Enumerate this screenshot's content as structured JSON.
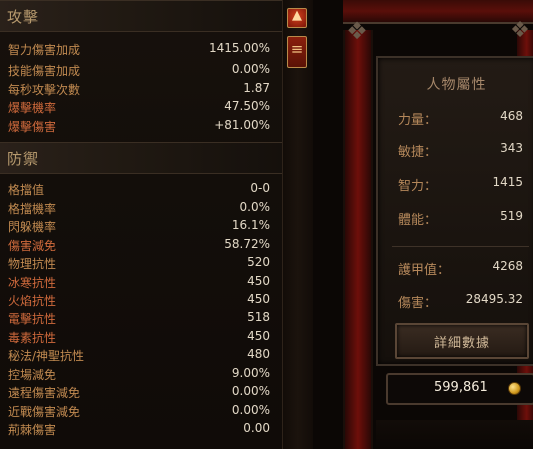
{
  "offense": {
    "title": "攻擊",
    "stats": [
      {
        "label": "智力傷害加成",
        "value": "1415.00%"
      },
      {
        "label": "技能傷害加成",
        "value": "0.00%"
      },
      {
        "label": "每秒攻擊次數",
        "value": "1.87"
      },
      {
        "label": "爆擊機率",
        "value": "47.50%"
      },
      {
        "label": "爆擊傷害",
        "value": "+81.00%"
      }
    ]
  },
  "defense": {
    "title": "防禦",
    "stats": [
      {
        "label": "格擋值",
        "value": "0-0"
      },
      {
        "label": "格擋機率",
        "value": "0.0%"
      },
      {
        "label": "閃躲機率",
        "value": "16.1%"
      },
      {
        "label": "傷害減免",
        "value": "58.72%"
      },
      {
        "label": "物理抗性",
        "value": "520"
      },
      {
        "label": "冰寒抗性",
        "value": "450"
      },
      {
        "label": "火焰抗性",
        "value": "450"
      },
      {
        "label": "電擊抗性",
        "value": "518"
      },
      {
        "label": "毒素抗性",
        "value": "450"
      },
      {
        "label": "秘法/神聖抗性",
        "value": "480"
      },
      {
        "label": "控場減免",
        "value": "9.00%"
      },
      {
        "label": "遠程傷害減免",
        "value": "0.00%"
      },
      {
        "label": "近戰傷害減免",
        "value": "0.00%"
      },
      {
        "label": "荊棘傷害",
        "value": "0.00"
      }
    ]
  },
  "attributes": {
    "title": "人物屬性",
    "primary": [
      {
        "label": "力量：",
        "value": "468"
      },
      {
        "label": "敏捷：",
        "value": "343"
      },
      {
        "label": "智力：",
        "value": "1415"
      },
      {
        "label": "體能：",
        "value": "519"
      }
    ],
    "secondary": [
      {
        "label": "護甲值：",
        "value": "4268"
      },
      {
        "label": "傷害：",
        "value": "28495.32"
      }
    ],
    "details_button": "詳細數據"
  },
  "gold": {
    "amount": "599,861",
    "icon": "gold-coin-icon"
  },
  "scrollbar": {
    "up_icon": "scroll-up-arrow-icon",
    "thumb_icon": "scroll-thumb-icon"
  },
  "colors": {
    "label_orange": "#c18a50",
    "label_red": "#d06a3c",
    "value_white": "#e2d8c6",
    "frame_red": "#6e0f0a"
  }
}
